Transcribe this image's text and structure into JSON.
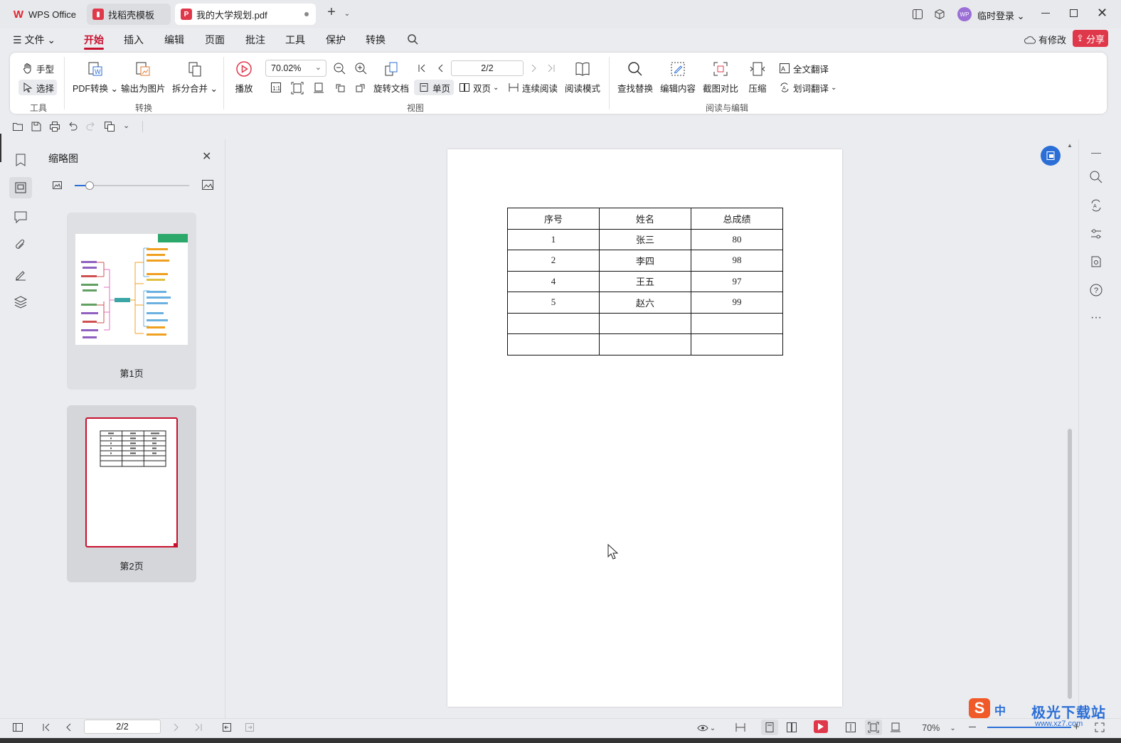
{
  "tabs": [
    {
      "label": "WPS Office",
      "icon": "wps-logo-icon"
    },
    {
      "label": "找稻壳模板",
      "icon": "docer-icon"
    },
    {
      "label": "我的大学规划.pdf",
      "icon": "pdf-icon"
    }
  ],
  "titlebar": {
    "login_label": "临时登录",
    "avatar_text": "WP"
  },
  "menu": {
    "file_label": "文件",
    "items": [
      "开始",
      "插入",
      "编辑",
      "页面",
      "批注",
      "工具",
      "保护",
      "转换"
    ],
    "active_index": 0,
    "modified_label": "有修改",
    "share_label": "分享"
  },
  "ribbon": {
    "hand_label": "手型",
    "select_label": "选择",
    "tools_group": "工具",
    "pdf_convert_label": "PDF转换",
    "export_image_label": "输出为图片",
    "split_merge_label": "拆分合并",
    "convert_group": "转换",
    "play_label": "播放",
    "zoom_value": "70.02%",
    "page_value": "2/2",
    "rotate_label": "旋转文档",
    "single_page_label": "单页",
    "double_page_label": "双页",
    "continuous_label": "连续阅读",
    "read_mode_label": "阅读模式",
    "view_group": "视图",
    "find_replace_label": "查找替换",
    "edit_content_label": "编辑内容",
    "screenshot_compare_label": "截图对比",
    "compress_label": "压缩",
    "full_translate_label": "全文翻译",
    "word_translate_label": "划词翻译",
    "read_edit_group": "阅读与编辑"
  },
  "thumbnail_panel": {
    "title": "缩略图",
    "slider_level": 0.13,
    "pages": [
      {
        "label": "第1页"
      },
      {
        "label": "第2页"
      }
    ]
  },
  "document": {
    "table": {
      "headers": [
        "序号",
        "姓名",
        "总成绩"
      ],
      "rows": [
        [
          "1",
          "张三",
          "80"
        ],
        [
          "2",
          "李四",
          "98"
        ],
        [
          "4",
          "王五",
          "97"
        ],
        [
          "5",
          "赵六",
          "99"
        ],
        [
          "",
          "",
          ""
        ],
        [
          "",
          "",
          ""
        ]
      ]
    }
  },
  "statusbar": {
    "page_value": "2/2",
    "zoom_label": "70%"
  },
  "watermark": {
    "text": "极光下载站",
    "url": "www.xz7.com",
    "ime": "中"
  },
  "colors": {
    "accent": "#c8102e",
    "blue": "#2b6fd6",
    "share": "#e0384b"
  }
}
